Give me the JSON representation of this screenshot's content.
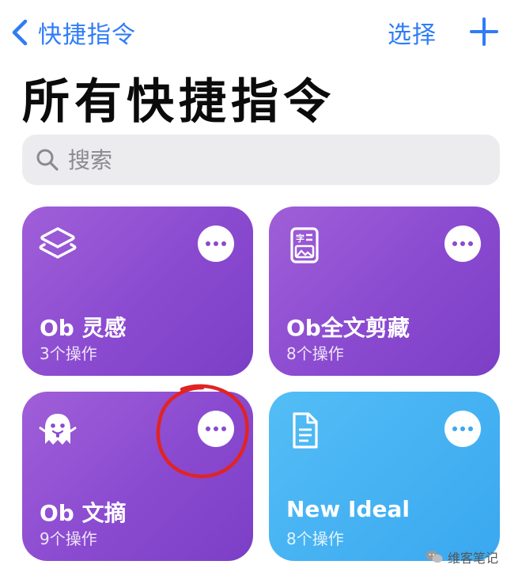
{
  "nav": {
    "back_label": "快捷指令",
    "select_label": "选择",
    "accent_color": "#2f7cf6"
  },
  "page_title": "所有快捷指令",
  "search": {
    "placeholder": "搜索"
  },
  "shortcuts": [
    {
      "title": "Ob 灵感",
      "subtitle": "3个操作",
      "icon": "layers-icon",
      "color": "#8a4ad0"
    },
    {
      "title": "Ob全文剪藏",
      "subtitle": "8个操作",
      "icon": "text-image-doc-icon",
      "color": "#8a4ad0"
    },
    {
      "title": "Ob 文摘",
      "subtitle": "9个操作",
      "icon": "ghost-icon",
      "color": "#8a4ad0"
    },
    {
      "title": "New Ideal",
      "subtitle": "8个操作",
      "icon": "document-icon",
      "color": "#3aa8f0"
    }
  ],
  "annotation": {
    "highlighted": "shortcuts.2.more-button",
    "color": "#e02424"
  },
  "watermark": {
    "text": "维客笔记",
    "icon": "wechat-icon"
  }
}
